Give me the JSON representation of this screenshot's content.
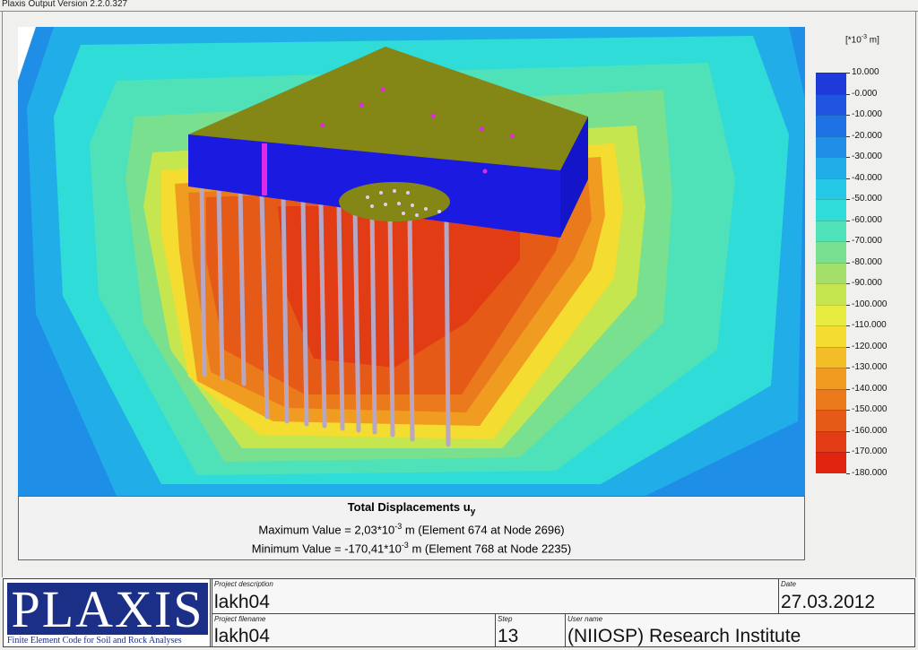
{
  "window": {
    "title": "Plaxis Output Version 2.2.0.327"
  },
  "plot": {
    "title": "Total Displacements u",
    "title_sub": "y",
    "unit_prefix": "[*10",
    "unit_exp": "-3",
    "unit_suffix": " m]",
    "max_prefix": "Maximum Value = 2,03*10",
    "max_exp": "-3",
    "max_suffix": " m (Element 674 at Node 2696)",
    "min_prefix": "Minimum Value = -170,41*10",
    "min_exp": "-3",
    "min_suffix": " m (Element 768 at Node 2235)"
  },
  "legend": {
    "labels": [
      "10.000",
      "-0.000",
      "-10.000",
      "-20.000",
      "-30.000",
      "-40.000",
      "-50.000",
      "-60.000",
      "-70.000",
      "-80.000",
      "-90.000",
      "-100.000",
      "-110.000",
      "-120.000",
      "-130.000",
      "-140.000",
      "-150.000",
      "-160.000",
      "-170.000",
      "-180.000"
    ],
    "colors": [
      "#1e3ad8",
      "#1f55e0",
      "#1f72e4",
      "#1f8ee6",
      "#21aee8",
      "#25c8e6",
      "#2fdcd8",
      "#4fe2b8",
      "#78e08e",
      "#a2e06a",
      "#c6e64f",
      "#e6ec40",
      "#f4dc30",
      "#f2bd26",
      "#ef9c20",
      "#ea7a1b",
      "#e55a17",
      "#e23c14",
      "#e02410"
    ]
  },
  "footer": {
    "logo_text": "PLAXIS",
    "logo_sub": "Finite Element Code for Soil and Rock Analyses",
    "project_description_label": "Project description",
    "project_description": "lakh04",
    "project_filename_label": "Project filename",
    "project_filename": "lakh04",
    "step_label": "Step",
    "step": "13",
    "user_label": "User name",
    "user": "(NIIOSP) Research Institute",
    "date_label": "Date",
    "date": "27.03.2012"
  }
}
